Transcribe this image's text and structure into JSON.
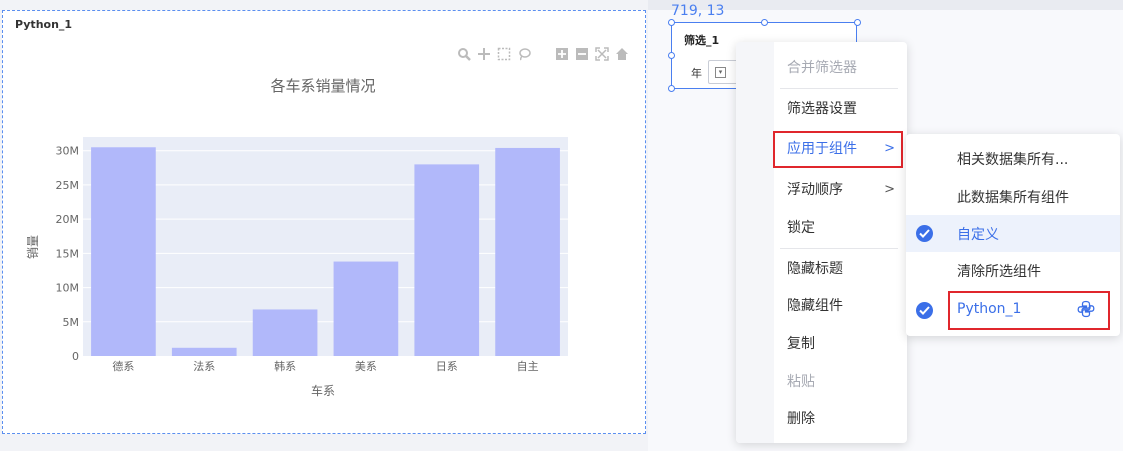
{
  "python_widget": {
    "title": "Python_1",
    "toolbar_icons": [
      "zoom-icon",
      "pan-icon",
      "box-select-icon",
      "lasso-icon",
      "zoom-in-icon",
      "zoom-out-icon",
      "autoscale-icon",
      "reset-axes-icon"
    ]
  },
  "chart_data": {
    "type": "bar",
    "title": "各车系销量情况",
    "xlabel": "车系",
    "ylabel": "销量",
    "categories": [
      "德系",
      "法系",
      "韩系",
      "美系",
      "日系",
      "自主"
    ],
    "values": [
      30500000,
      1200000,
      6800000,
      13800000,
      28000000,
      30400000
    ],
    "ylim": [
      0,
      32000000
    ],
    "yticks": [
      0,
      5000000,
      10000000,
      15000000,
      20000000,
      25000000,
      30000000
    ],
    "ytick_labels": [
      "0",
      "5M",
      "10M",
      "15M",
      "20M",
      "25M",
      "30M"
    ],
    "grid": true,
    "colors": {
      "bar": "#b1b8fa",
      "plot_bg": "#e9edf7",
      "grid": "#ffffff"
    }
  },
  "filter_widget": {
    "coord_readout": "719, 13",
    "title": "筛选_1",
    "field_label": "年"
  },
  "context_menu": {
    "items": [
      {
        "label": "合并筛选器",
        "disabled": true
      },
      {
        "label": "筛选器设置"
      },
      {
        "label": "应用于组件",
        "active": true,
        "has_submenu": true
      },
      {
        "label": "浮动顺序",
        "has_submenu": true
      },
      {
        "label": "锁定"
      },
      {
        "label": "隐藏标题"
      },
      {
        "label": "隐藏组件"
      },
      {
        "label": "复制"
      },
      {
        "label": "粘贴",
        "disabled": true
      },
      {
        "label": "删除"
      }
    ],
    "arrow": ">"
  },
  "submenu": {
    "items": [
      {
        "label": "相关数据集所有...",
        "checked": false
      },
      {
        "label": "此数据集所有组件",
        "checked": false
      },
      {
        "label": "自定义",
        "checked": true
      },
      {
        "label": "清除所选组件",
        "checked": false
      },
      {
        "label": "Python_1",
        "checked": true,
        "icon": "python-icon"
      }
    ]
  },
  "colors": {
    "accent": "#3b6fe8",
    "highlight_border": "#e0262c"
  }
}
